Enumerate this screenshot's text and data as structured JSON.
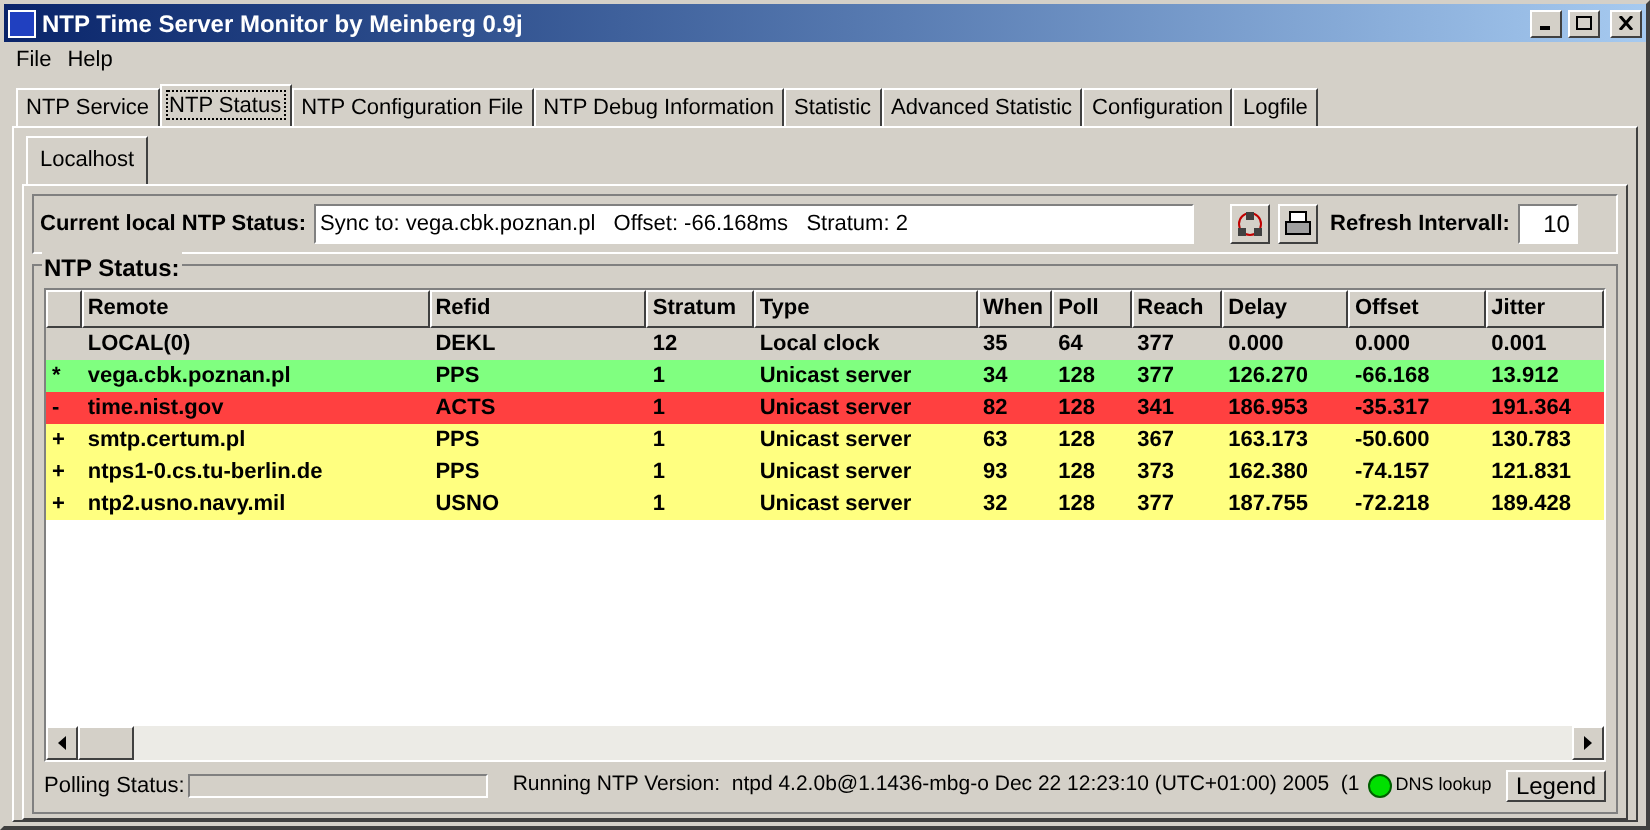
{
  "window": {
    "title": "NTP Time Server Monitor by Meinberg 0.9j"
  },
  "menu": [
    "File",
    "Help"
  ],
  "tabs": [
    {
      "label": "NTP Service",
      "selected": false
    },
    {
      "label": "NTP Status",
      "selected": true
    },
    {
      "label": "NTP Configuration File",
      "selected": false
    },
    {
      "label": "NTP Debug Information",
      "selected": false
    },
    {
      "label": "Statistic",
      "selected": false
    },
    {
      "label": "Advanced Statistic",
      "selected": false
    },
    {
      "label": "Configuration",
      "selected": false
    },
    {
      "label": "Logfile",
      "selected": false
    }
  ],
  "host_tabs": [
    {
      "label": "Localhost",
      "selected": true
    }
  ],
  "current_status": {
    "label": "Current local NTP Status:",
    "value": "Sync to: vega.cbk.poznan.pl   Offset: -66.168ms   Stratum: 2",
    "refresh_label": "Refresh Intervall:",
    "refresh_value": "10"
  },
  "table": {
    "title": "NTP Status:",
    "columns": [
      "",
      "Remote",
      "Refid",
      "Stratum",
      "Type",
      "When",
      "Poll",
      "Reach",
      "Delay",
      "Offset",
      "Jitter"
    ],
    "rows": [
      {
        "color": "#d4d0c8",
        "cells": [
          "",
          "LOCAL(0)",
          "DEKL",
          "12",
          "Local clock",
          "35",
          "64",
          "377",
          "0.000",
          "0.000",
          "0.001"
        ]
      },
      {
        "color": "#80ff80",
        "cells": [
          "*",
          "vega.cbk.poznan.pl",
          "PPS",
          "1",
          "Unicast server",
          "34",
          "128",
          "377",
          "126.270",
          "-66.168",
          "13.912"
        ]
      },
      {
        "color": "#ff4040",
        "cells": [
          "-",
          "time.nist.gov",
          "ACTS",
          "1",
          "Unicast server",
          "82",
          "128",
          "341",
          "186.953",
          "-35.317",
          "191.364"
        ]
      },
      {
        "color": "#ffff80",
        "cells": [
          "+",
          "smtp.certum.pl",
          "PPS",
          "1",
          "Unicast server",
          "63",
          "128",
          "367",
          "163.173",
          "-50.600",
          "130.783"
        ]
      },
      {
        "color": "#ffff80",
        "cells": [
          "+",
          "ntps1-0.cs.tu-berlin.de",
          "PPS",
          "1",
          "Unicast server",
          "93",
          "128",
          "373",
          "162.380",
          "-74.157",
          "121.831"
        ]
      },
      {
        "color": "#ffff80",
        "cells": [
          "+",
          "ntp2.usno.navy.mil",
          "USNO",
          "1",
          "Unicast server",
          "32",
          "128",
          "377",
          "187.755",
          "-72.218",
          "189.428"
        ]
      }
    ]
  },
  "status_bar": {
    "polling_label": "Polling Status:",
    "polling": {
      "level": 0
    },
    "version": "Running NTP Version:  ntpd 4.2.0b@1.1436-mbg-o Dec 22 12:23:10 (UTC+01:00) 2005  (1",
    "dns": {
      "label": "DNS lookup",
      "color": "#00e000"
    },
    "legend": "Legend"
  }
}
